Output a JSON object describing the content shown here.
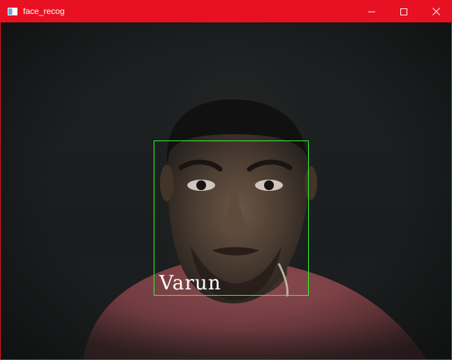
{
  "window": {
    "title": "face_recog",
    "accent_color": "#e81123",
    "controls": {
      "minimize_icon": "minimize-icon",
      "maximize_icon": "maximize-icon",
      "close_icon": "close-icon"
    }
  },
  "video": {
    "detection": {
      "label": "Varun",
      "box_color": "#33ff33"
    }
  }
}
